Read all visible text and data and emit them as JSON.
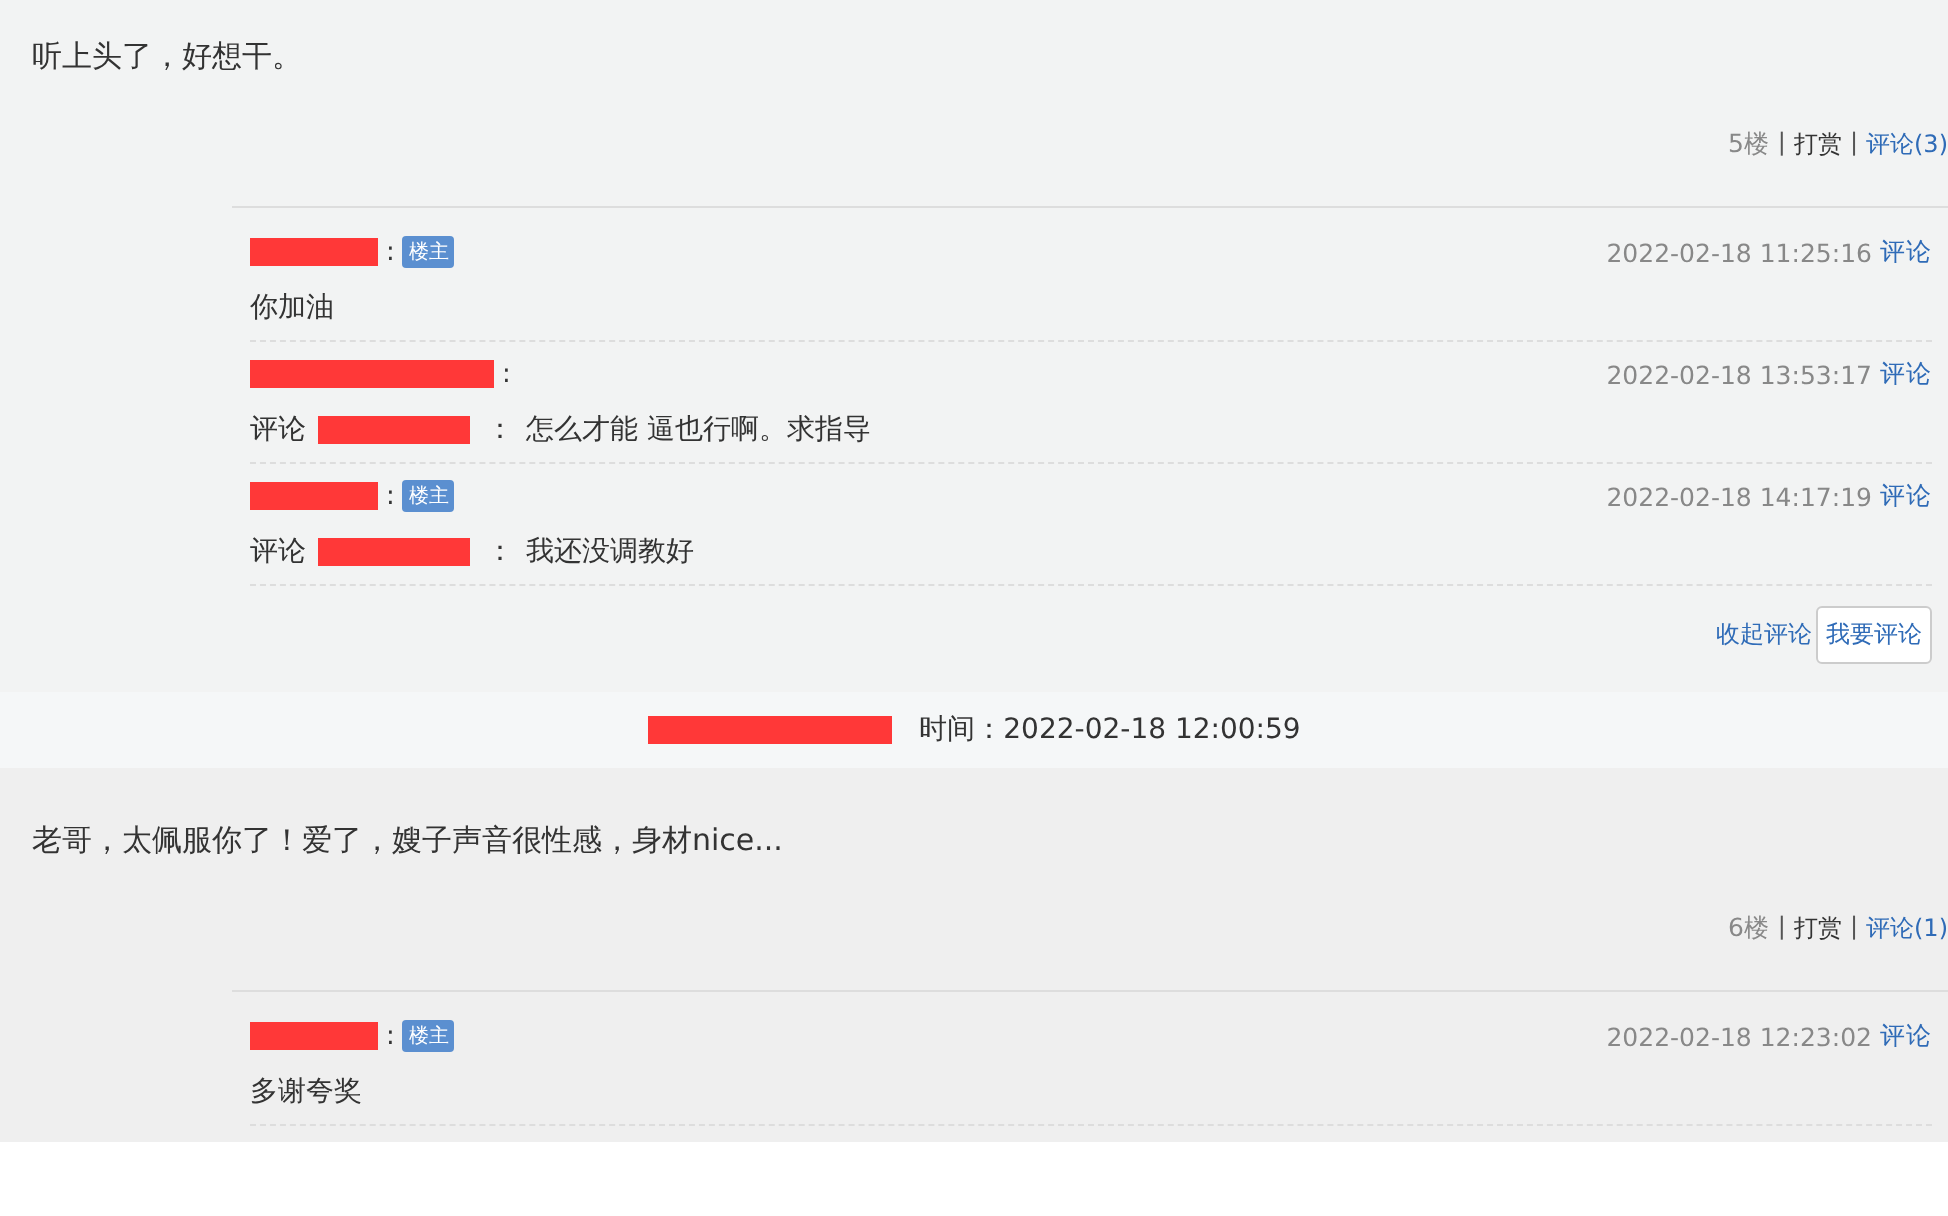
{
  "floors": [
    {
      "content": "听上头了，好想干。",
      "floor": "5楼",
      "sep_1": "|",
      "reward": "打赏",
      "sep_2": "|",
      "comments_link": "评论(3)",
      "comments": [
        {
          "name_colon": ":",
          "badge": "楼主",
          "text": "你加油",
          "time": "2022-02-18 11:25:16",
          "reply": "评论"
        },
        {
          "name_colon": ":",
          "reply_label": "评论",
          "reply_colon": "：",
          "text": "怎么才能 逼也行啊。求指导",
          "time": "2022-02-18 13:53:17",
          "reply": "评论"
        },
        {
          "name_colon": ":",
          "badge": "楼主",
          "reply_label": "评论",
          "reply_colon": "：",
          "text": "我还没调教好",
          "time": "2022-02-18 14:17:19",
          "reply": "评论"
        }
      ],
      "collapse": "收起评论",
      "write": "我要评论"
    },
    {
      "header_time": "时间：2022-02-18 12:00:59",
      "content": "老哥，太佩服你了！爱了，嫂子声音很性感，身材nice...",
      "floor": "6楼",
      "sep_1": "|",
      "reward": "打赏",
      "sep_2": "|",
      "comments_link": "评论(1)",
      "comments": [
        {
          "name_colon": ":",
          "badge": "楼主",
          "text": "多谢夸奖",
          "time": "2022-02-18 12:23:02",
          "reply": "评论"
        }
      ]
    }
  ]
}
